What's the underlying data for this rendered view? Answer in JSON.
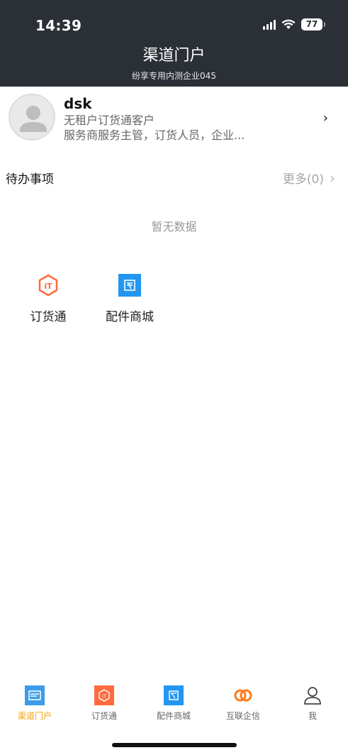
{
  "status_bar": {
    "time": "14:39",
    "battery": "77"
  },
  "header": {
    "title": "渠道门户",
    "subtitle": "纷享专用内测企业045"
  },
  "profile": {
    "name": "dsk",
    "company": "无租户订货通客户",
    "roles": "服务商服务主管，订货人员，企业...",
    "chevron": "›"
  },
  "todo": {
    "title": "待办事项",
    "more": "更多(0)",
    "empty": "暂无数据"
  },
  "apps": [
    {
      "label": "订货通",
      "icon": "order-hexagon-icon",
      "color": "#ff6a3d"
    },
    {
      "label": "配件商城",
      "icon": "parts-mall-icon",
      "color": "#2196f3"
    }
  ],
  "tabbar": {
    "items": [
      {
        "label": "渠道门户",
        "icon": "channel-portal-icon",
        "active": true
      },
      {
        "label": "订货通",
        "icon": "order-icon"
      },
      {
        "label": "配件商城",
        "icon": "parts-mall-icon"
      },
      {
        "label": "互联企信",
        "icon": "interconnect-icon"
      },
      {
        "label": "我",
        "icon": "person-icon"
      }
    ]
  },
  "colors": {
    "header_bg": "#2b2f36",
    "accent": "#f7a400",
    "orange": "#ff6a3d",
    "blue": "#2196f3"
  }
}
